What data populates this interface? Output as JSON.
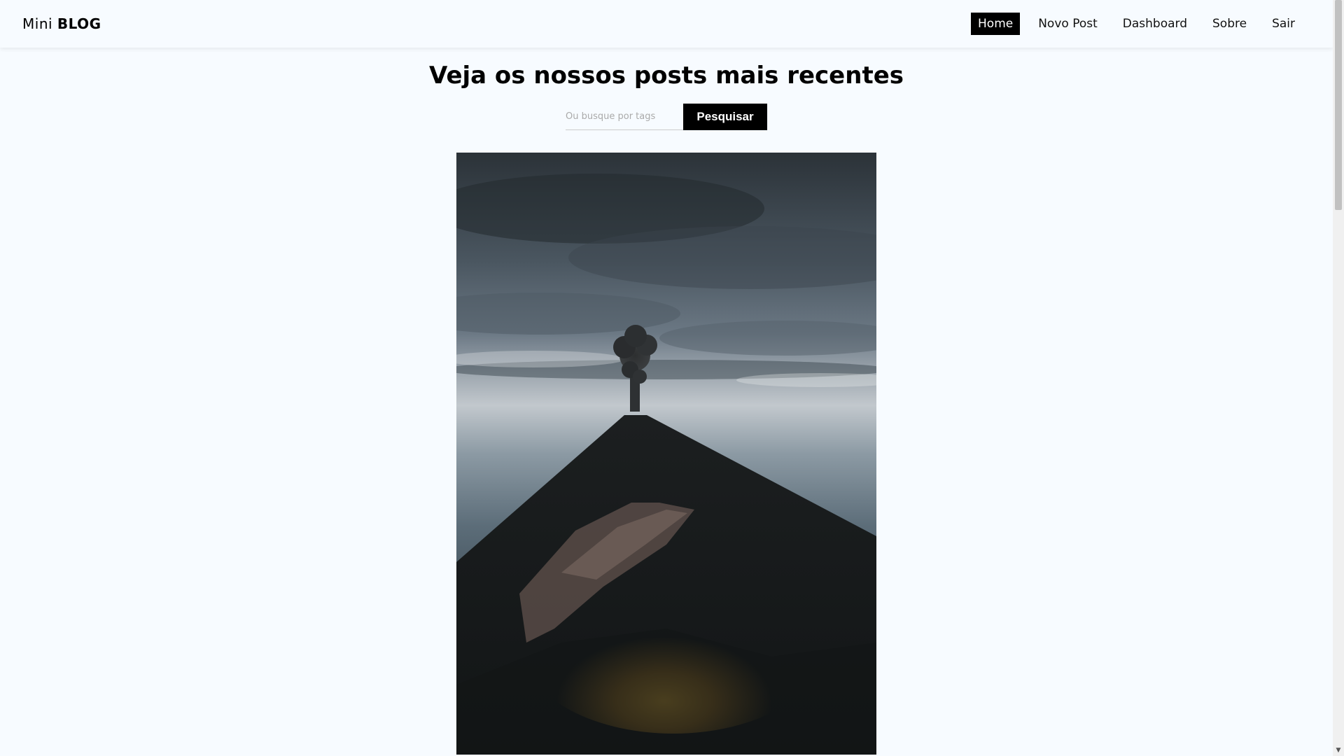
{
  "brand": {
    "prefix": "Mini",
    "name": "BLOG"
  },
  "nav": {
    "items": [
      {
        "label": "Home",
        "active": true
      },
      {
        "label": "Novo Post",
        "active": false
      },
      {
        "label": "Dashboard",
        "active": false
      },
      {
        "label": "Sobre",
        "active": false
      },
      {
        "label": "Sair",
        "active": false
      }
    ]
  },
  "main": {
    "title": "Veja os nossos posts mais recentes",
    "search": {
      "placeholder": "Ou busque por tags",
      "value": "",
      "button_label": "Pesquisar"
    }
  },
  "colors": {
    "background": "#f7fbff",
    "accent": "#000000"
  },
  "icons": {
    "scroll_down": "chevron-down-icon"
  }
}
